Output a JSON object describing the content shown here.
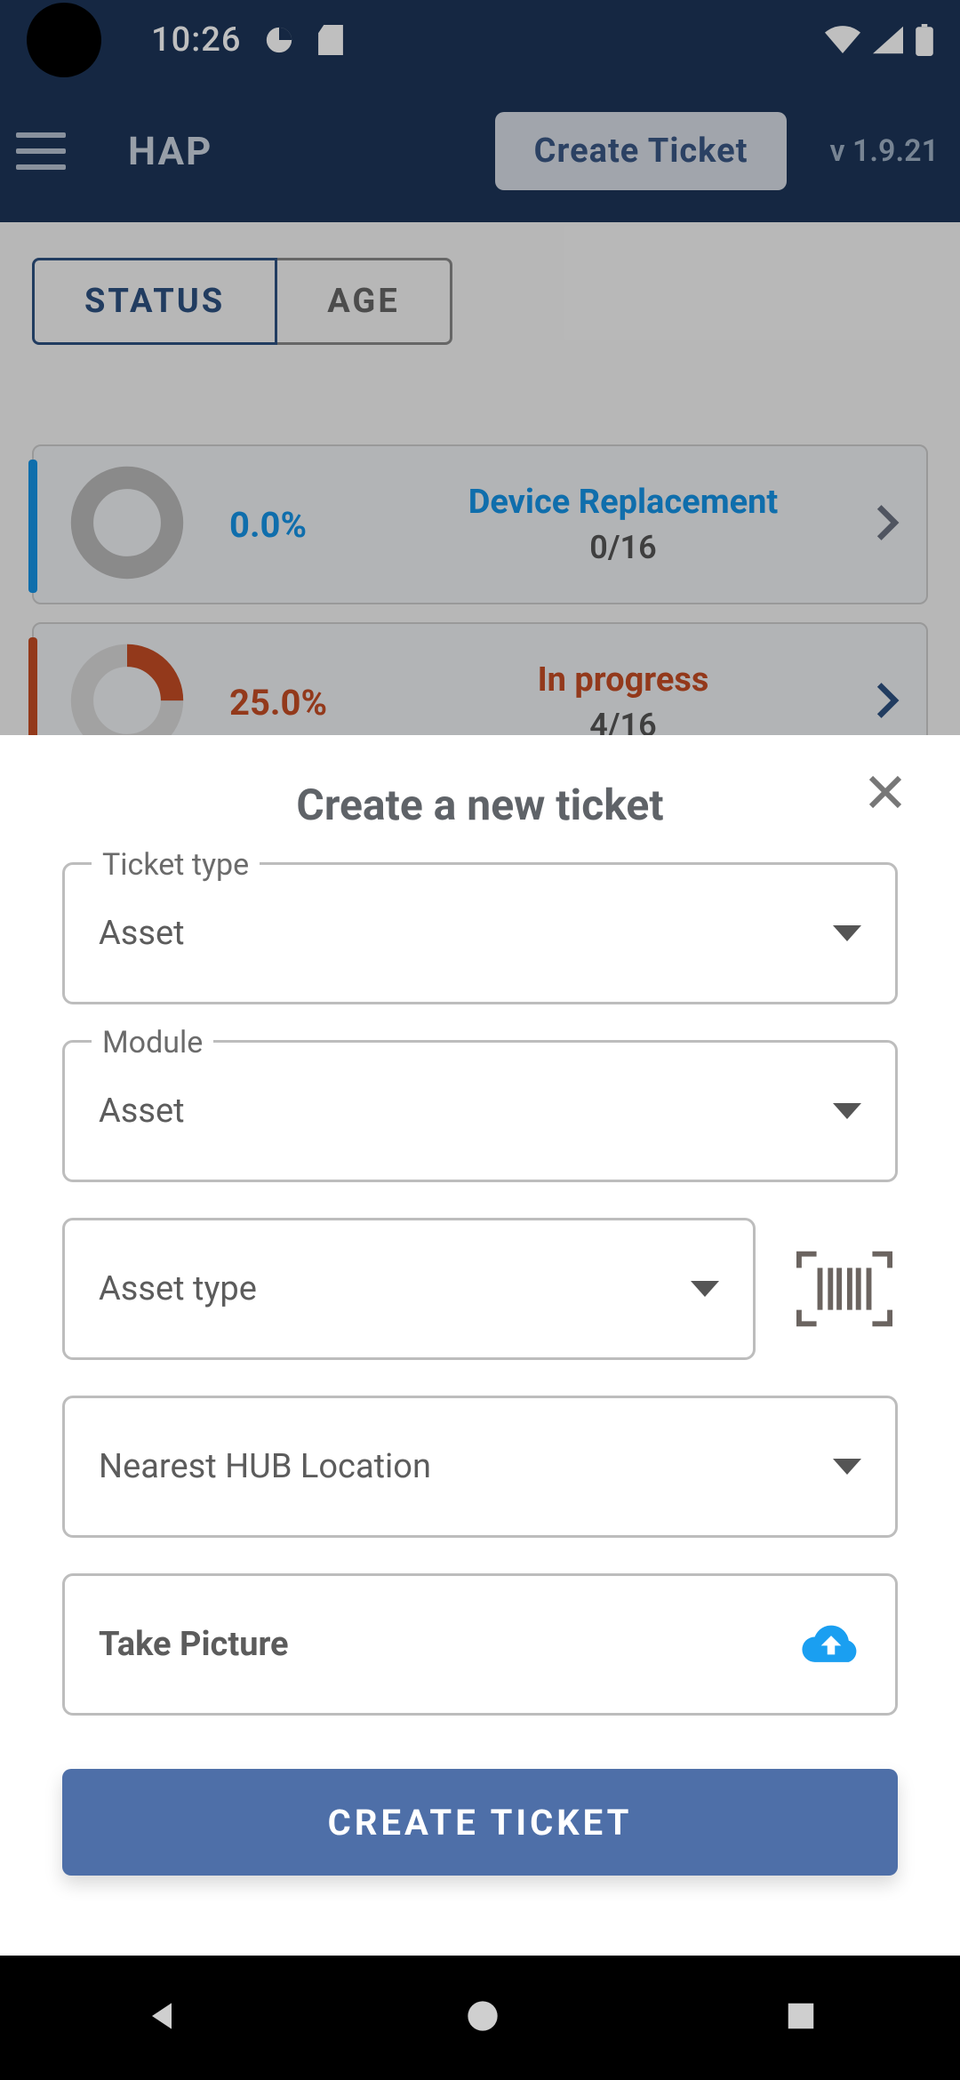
{
  "statusbar": {
    "time": "10:26"
  },
  "toolbar": {
    "brand": "HAP",
    "create_label": "Create Ticket",
    "version": "v 1.9.21"
  },
  "tabs": {
    "status": "STATUS",
    "age": "AGE"
  },
  "cards": [
    {
      "percent": "0.0%",
      "title": "Device Replacement",
      "sub": "0/16"
    },
    {
      "percent": "25.0%",
      "title": "In progress",
      "sub": "4/16"
    }
  ],
  "sheet": {
    "title": "Create a new ticket",
    "ticket_type": {
      "label": "Ticket type",
      "value": "Asset"
    },
    "module": {
      "label": "Module",
      "value": "Asset"
    },
    "asset_type": {
      "placeholder": "Asset type"
    },
    "hub": {
      "placeholder": "Nearest HUB Location"
    },
    "picture": {
      "label": "Take Picture"
    },
    "submit": "CREATE TICKET"
  }
}
